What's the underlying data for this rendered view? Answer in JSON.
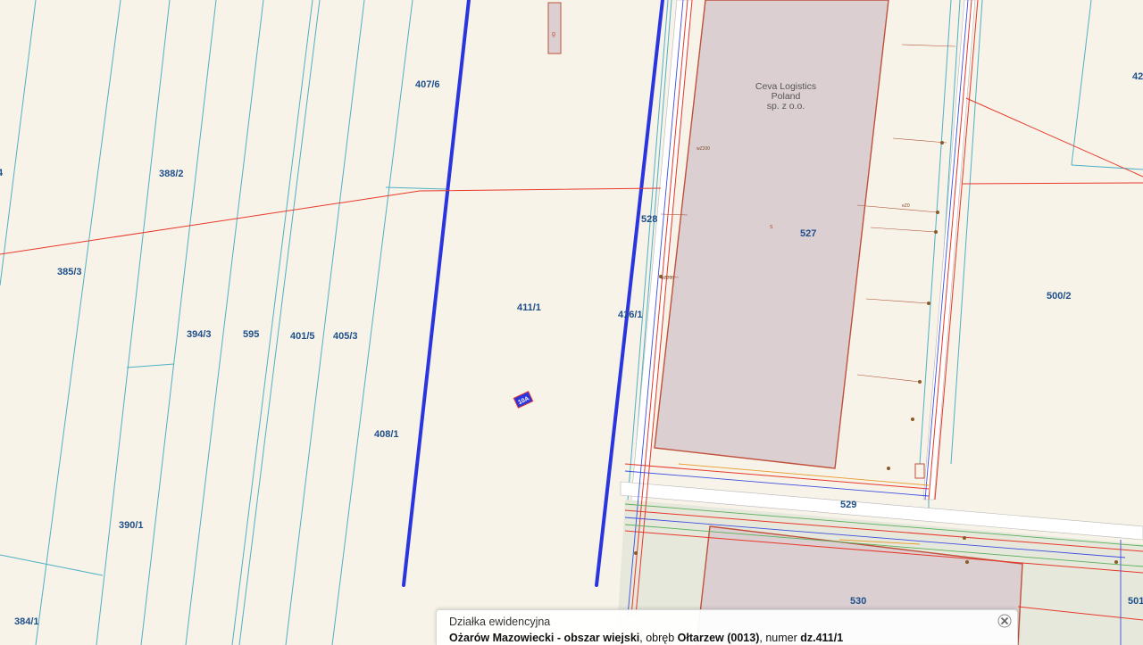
{
  "map": {
    "parcels": [
      {
        "id": "p-4",
        "label": "4"
      },
      {
        "id": "p-42",
        "label": "42"
      },
      {
        "id": "p-388-2",
        "label": "388/2"
      },
      {
        "id": "p-407-6",
        "label": "407/6"
      },
      {
        "id": "p-385-3",
        "label": "385/3"
      },
      {
        "id": "p-394-3",
        "label": "394/3"
      },
      {
        "id": "p-595",
        "label": "595"
      },
      {
        "id": "p-401-5",
        "label": "401/5"
      },
      {
        "id": "p-405-3",
        "label": "405/3"
      },
      {
        "id": "p-411-1",
        "label": "411/1"
      },
      {
        "id": "p-416-1",
        "label": "416/1"
      },
      {
        "id": "p-528",
        "label": "528"
      },
      {
        "id": "p-527",
        "label": "527"
      },
      {
        "id": "p-500-2",
        "label": "500/2"
      },
      {
        "id": "p-408-1",
        "label": "408/1"
      },
      {
        "id": "p-390-1",
        "label": "390/1"
      },
      {
        "id": "p-384-1",
        "label": "384/1"
      },
      {
        "id": "p-529",
        "label": "529"
      },
      {
        "id": "p-530",
        "label": "530"
      },
      {
        "id": "p-501",
        "label": "501"
      }
    ],
    "building_name": [
      "Ceva Logistics",
      "Poland",
      "sp. z o.o."
    ],
    "building_markers": {
      "small_building": "g",
      "main_building": "s",
      "address_marker": "10A"
    },
    "colors": {
      "background": "#f7f3e8",
      "parcel_boundary": "#4fb0c6",
      "selected_parcel": "#2a35e0",
      "utility_line": "#e8382a",
      "building_fill": "#dccfd2",
      "building_outline": "#c0503a",
      "road_fill": "#e6e8dc",
      "label": "#1e4f8a"
    }
  },
  "infobox": {
    "title": "Działka ewidencyjna",
    "location": "Ożarów Mazowiecki - obszar wiejski",
    "precinct_prefix": ", obręb ",
    "precinct": "Ołtarzew (0013)",
    "number_prefix": ", numer ",
    "number": "dz.411/1",
    "close_icon": "close-x-icon"
  }
}
